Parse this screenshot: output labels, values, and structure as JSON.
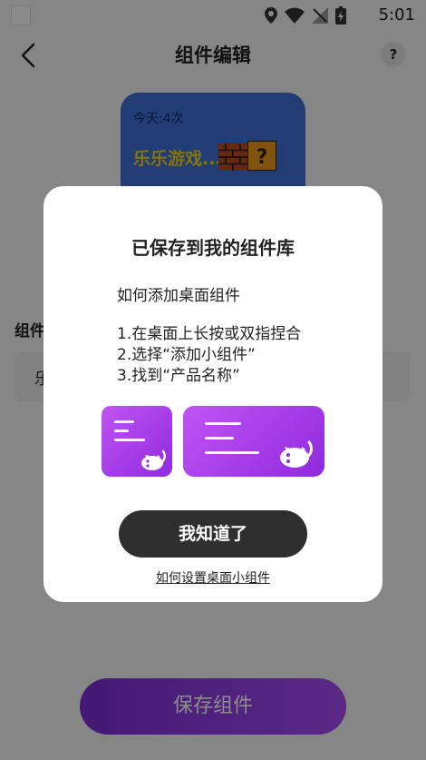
{
  "status_bar": {
    "time": "5:01"
  },
  "header": {
    "title": "组件编辑",
    "help_label": "?"
  },
  "widget_preview": {
    "count_text": "今天:4次",
    "game_title": "乐乐游戏..."
  },
  "form": {
    "section_label": "组件",
    "name_value": "乐"
  },
  "save_button": {
    "label": "保存组件"
  },
  "dialog": {
    "title": "已保存到我的组件库",
    "subtitle": "如何添加桌面组件",
    "steps": [
      "1.在桌面上长按或双指捏合",
      "2.选择“添加小组件”",
      "3.找到“产品名称”"
    ],
    "confirm_label": "我知道了",
    "help_link": "如何设置桌面小组件"
  },
  "colors": {
    "accent_purple": "#a64cf0",
    "widget_blue": "#3f6ed6",
    "dark_button": "#2f2f2f"
  }
}
